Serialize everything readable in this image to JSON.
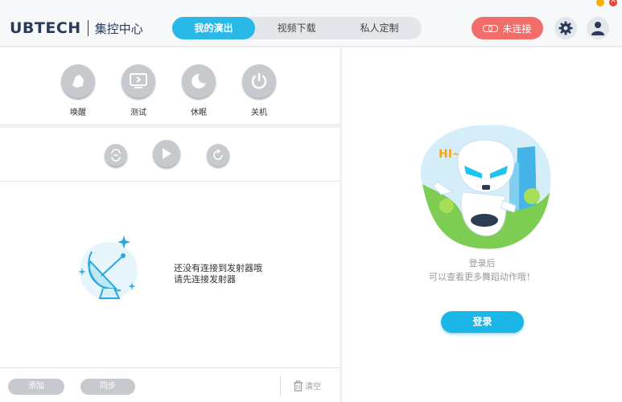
{
  "header": {
    "logo_brand": "UBTECH",
    "logo_sub": "集控中心",
    "tabs": [
      {
        "label": "我的演出",
        "active": true
      },
      {
        "label": "视频下载",
        "active": false
      },
      {
        "label": "私人定制",
        "active": false
      }
    ],
    "connect_label": "未连接",
    "icons": {
      "settings": "gear-icon",
      "account": "user-icon",
      "link": "link-icon"
    }
  },
  "actions": [
    {
      "label": "唤醒",
      "icon": "wake-icon"
    },
    {
      "label": "测试",
      "icon": "test-icon"
    },
    {
      "label": "休眠",
      "icon": "sleep-icon"
    },
    {
      "label": "关机",
      "icon": "power-icon"
    }
  ],
  "player": {
    "icons": [
      "loop-icon",
      "play-icon",
      "refresh-icon"
    ]
  },
  "empty_state": {
    "line1": "还没有连接到发射器哦",
    "line2": "请先连接发射器",
    "icon": "satellite-dish-icon"
  },
  "bottom": {
    "add_label": "添加",
    "sync_label": "同步",
    "clear_label": "清空",
    "clear_icon": "trash-icon"
  },
  "right": {
    "greeting": "HI~",
    "hint_line1": "登录后",
    "hint_line2": "可以查看更多舞蹈动作哦！",
    "login_label": "登录"
  },
  "colors": {
    "accent": "#29b8e8",
    "danger": "#f26c69",
    "muted_button": "#c6c9ce",
    "brand_text": "#2a3b57"
  }
}
